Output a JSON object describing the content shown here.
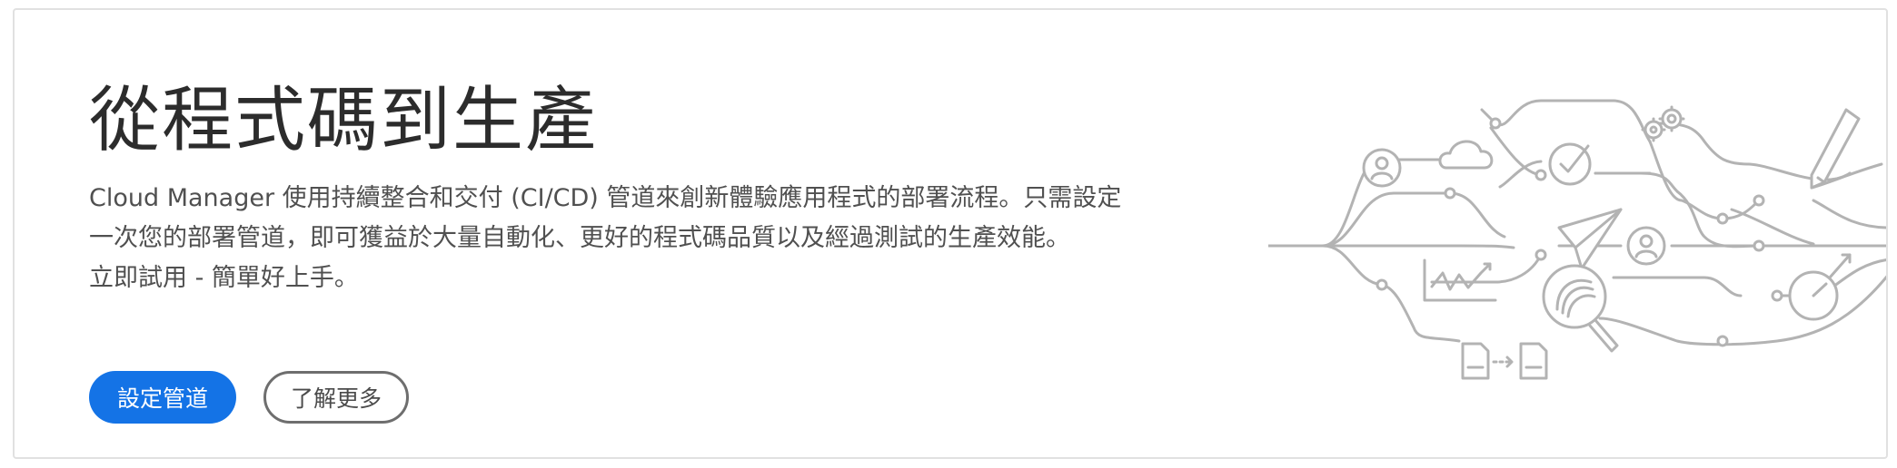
{
  "hero": {
    "title": "從程式碼到生產",
    "description_lines": [
      "Cloud Manager 使用持續整合和交付 (CI/CD) 管道來創新體驗應用程式的部署流程。只需設定",
      "一次您的部署管道，即可獲益於大量自動化、更好的程式碼品質以及經過測試的生產效能。",
      "立即試用 - 簡單好上手。"
    ],
    "primary_button_label": "設定管道",
    "secondary_button_label": "了解更多"
  },
  "colors": {
    "primary_blue": "#1473e6",
    "illustration_gray": "#b3b3b3",
    "title_text": "#2c2c2c",
    "body_text": "#505050"
  },
  "illustration": {
    "icons": [
      "user-icon",
      "cloud-icon",
      "checkmark-icon",
      "gears-icon",
      "pen-icon",
      "paper-plane-icon",
      "chart-icon",
      "magnifier-icon",
      "user-icon",
      "speedometer-icon",
      "document-icon",
      "document-icon"
    ]
  }
}
